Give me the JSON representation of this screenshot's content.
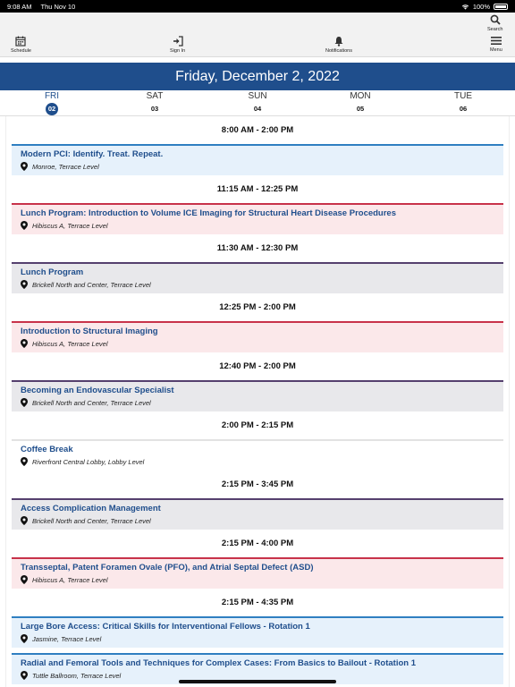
{
  "status_bar": {
    "time": "9:08 AM",
    "date": "Thu Nov 10",
    "battery": "100%"
  },
  "toolbar": {
    "schedule_label": "Schedule",
    "signin_label": "Sign In",
    "notifications_label": "Notifications",
    "search_label": "Search",
    "menu_label": "Menu"
  },
  "date_banner": "Friday, December 2, 2022",
  "days": [
    {
      "name": "FRI",
      "num": "02",
      "active": true
    },
    {
      "name": "SAT",
      "num": "03",
      "active": false
    },
    {
      "name": "SUN",
      "num": "04",
      "active": false
    },
    {
      "name": "MON",
      "num": "05",
      "active": false
    },
    {
      "name": "TUE",
      "num": "06",
      "active": false
    }
  ],
  "colors": {
    "accent": "#1f4e8c",
    "blue_bg": "#e6f1fb",
    "blue_border": "#2f7fc1",
    "red_bg": "#fbe8ea",
    "red_border": "#c8324a",
    "gray_bg": "#e8e8eb",
    "purple_border": "#55406e",
    "plain_bg": "#ffffff",
    "plain_border": "#e2e2e2"
  },
  "sessions": [
    {
      "time": "8:00 AM - 2:00 PM",
      "title": "Modern PCI: Identify. Treat. Repeat.",
      "location": "Monroe, Terrace Level",
      "theme": "blue"
    },
    {
      "time": "11:15 AM - 12:25 PM",
      "title": "Lunch Program: Introduction to Volume ICE Imaging for Structural Heart Disease Procedures",
      "location": "Hibiscus A, Terrace Level",
      "theme": "red"
    },
    {
      "time": "11:30 AM - 12:30 PM",
      "title": "Lunch Program",
      "location": "Brickell North and Center, Terrace Level",
      "theme": "purple"
    },
    {
      "time": "12:25 PM - 2:00 PM",
      "title": "Introduction to Structural Imaging",
      "location": "Hibiscus A, Terrace Level",
      "theme": "red"
    },
    {
      "time": "12:40 PM - 2:00 PM",
      "title": "Becoming an Endovascular Specialist",
      "location": "Brickell North and Center, Terrace Level",
      "theme": "purple"
    },
    {
      "time": "2:00 PM - 2:15 PM",
      "title": "Coffee Break",
      "location": "Riverfront Central Lobby, Lobby Level",
      "theme": "plain"
    },
    {
      "time": "2:15 PM - 3:45 PM",
      "title": "Access Complication Management",
      "location": "Brickell North and Center, Terrace Level",
      "theme": "purple"
    },
    {
      "time": "2:15 PM - 4:00 PM",
      "title": "Transseptal, Patent Foramen Ovale (PFO), and Atrial Septal Defect (ASD)",
      "location": "Hibiscus A, Terrace Level",
      "theme": "red"
    },
    {
      "time": "2:15 PM - 4:35 PM",
      "title": "Large Bore Access: Critical Skills for Interventional Fellows - Rotation 1",
      "location": "Jasmine, Terrace Level",
      "theme": "blue"
    },
    {
      "time": null,
      "title": "Radial and Femoral Tools and Techniques for Complex Cases: From Basics to Bailout - Rotation 1",
      "location": "Tuttle Ballroom, Terrace Level",
      "theme": "blue"
    }
  ]
}
